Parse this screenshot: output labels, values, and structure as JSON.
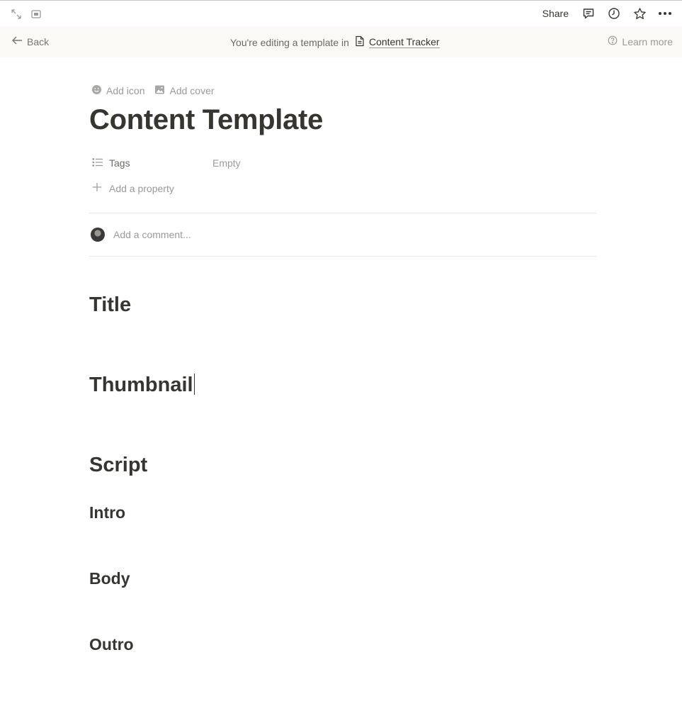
{
  "topbar": {
    "share_label": "Share",
    "icons": [
      "expand-icon",
      "sidebar-peek-icon",
      "comment-icon",
      "history-clock-icon",
      "star-icon",
      "more-icon"
    ]
  },
  "banner": {
    "back_label": "Back",
    "editing_text": "You're editing a template in",
    "database_name": "Content Tracker",
    "learn_more": "Learn more"
  },
  "page": {
    "add_icon": "Add icon",
    "add_cover": "Add cover",
    "title": "Content Template",
    "properties": [
      {
        "name": "Tags",
        "value": "Empty"
      }
    ],
    "add_property": "Add a property",
    "comment_placeholder": "Add a comment..."
  },
  "content": {
    "headings": [
      {
        "text": "Title",
        "level": 1
      },
      {
        "text": "Thumbnail",
        "level": 1
      },
      {
        "text": "Script",
        "level": 1
      },
      {
        "text": "Intro",
        "level": 3
      },
      {
        "text": "Body",
        "level": 3
      },
      {
        "text": "Outro",
        "level": 3
      }
    ]
  },
  "colors": {
    "text": "#37352f",
    "muted": "#9b9a97",
    "banner_bg": "#fbf9f6",
    "divider": "#e9e9e7"
  }
}
